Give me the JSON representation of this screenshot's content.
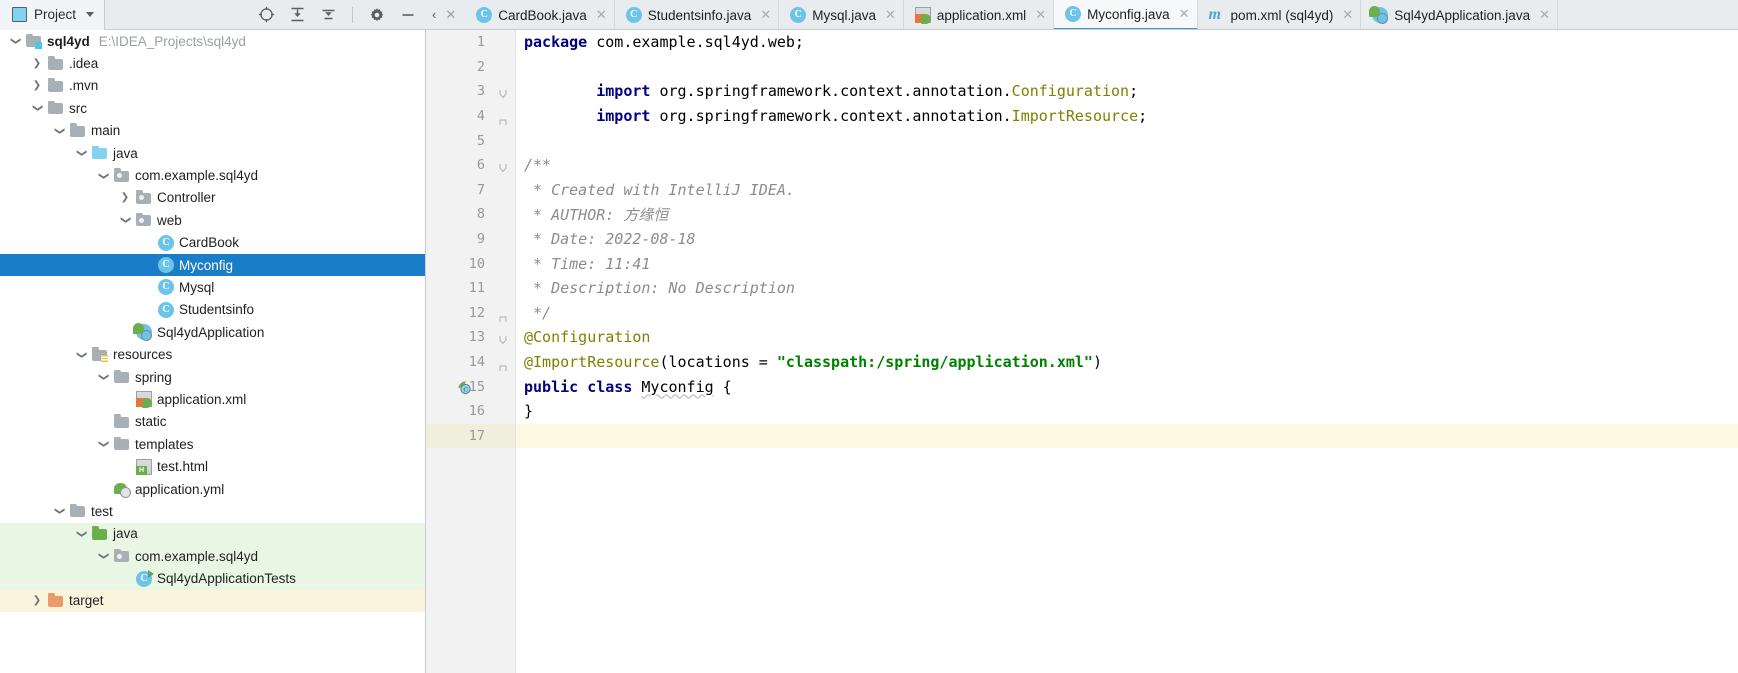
{
  "project_toolbar": {
    "tab_label": "Project",
    "icons": [
      {
        "name": "locate-icon",
        "glyph": "crosshair"
      },
      {
        "name": "expand-all-icon",
        "glyph": "expand"
      },
      {
        "name": "collapse-all-icon",
        "glyph": "collapse"
      },
      {
        "name": "settings-gear-icon",
        "glyph": "gear"
      },
      {
        "name": "minimize-icon",
        "glyph": "minus"
      }
    ]
  },
  "editor_tabs": {
    "scroll_left_label": "‹",
    "close_all_label": "✕",
    "items": [
      {
        "label": "CardBook.java",
        "icon": "java-class-icon",
        "icon_glyph": "C",
        "active": false
      },
      {
        "label": "Studentsinfo.java",
        "icon": "java-class-icon",
        "icon_glyph": "C",
        "active": false
      },
      {
        "label": "Mysql.java",
        "icon": "java-class-icon",
        "icon_glyph": "C",
        "active": false
      },
      {
        "label": "application.xml",
        "icon": "spring-xml-icon",
        "icon_glyph": "",
        "active": false
      },
      {
        "label": "Myconfig.java",
        "icon": "java-class-icon",
        "icon_glyph": "C",
        "active": true
      },
      {
        "label": "pom.xml (sql4yd)",
        "icon": "maven-icon",
        "icon_glyph": "m",
        "active": false
      },
      {
        "label": "Sql4ydApplication.java",
        "icon": "spring-boot-class-icon",
        "icon_glyph": "C",
        "active": false
      }
    ],
    "close_glyph": "✕"
  },
  "project_tree": {
    "rows": [
      {
        "indent": 0,
        "arrow": "down",
        "icon": "module-folder-icon",
        "label": "sql4yd",
        "path": "E:\\IDEA_Projects\\sql4yd",
        "bold": true,
        "state": "normal"
      },
      {
        "indent": 1,
        "arrow": "right",
        "icon": "folder-icon",
        "label": ".idea",
        "path": "",
        "bold": false,
        "state": "normal"
      },
      {
        "indent": 1,
        "arrow": "right",
        "icon": "folder-icon",
        "label": ".mvn",
        "path": "",
        "bold": false,
        "state": "normal"
      },
      {
        "indent": 1,
        "arrow": "down",
        "icon": "folder-icon",
        "label": "src",
        "path": "",
        "bold": false,
        "state": "normal"
      },
      {
        "indent": 2,
        "arrow": "down",
        "icon": "folder-icon",
        "label": "main",
        "path": "",
        "bold": false,
        "state": "normal"
      },
      {
        "indent": 3,
        "arrow": "down",
        "icon": "source-folder-icon",
        "label": "java",
        "path": "",
        "bold": false,
        "state": "normal"
      },
      {
        "indent": 4,
        "arrow": "down",
        "icon": "package-icon",
        "label": "com.example.sql4yd",
        "path": "",
        "bold": false,
        "state": "normal"
      },
      {
        "indent": 5,
        "arrow": "right",
        "icon": "package-icon",
        "label": "Controller",
        "path": "",
        "bold": false,
        "state": "normal"
      },
      {
        "indent": 5,
        "arrow": "down",
        "icon": "package-icon",
        "label": "web",
        "path": "",
        "bold": false,
        "state": "normal"
      },
      {
        "indent": 6,
        "arrow": "none",
        "icon": "java-class-icon",
        "label": "CardBook",
        "path": "",
        "bold": false,
        "state": "normal"
      },
      {
        "indent": 6,
        "arrow": "none",
        "icon": "java-class-icon",
        "label": "Myconfig",
        "path": "",
        "bold": false,
        "state": "selected"
      },
      {
        "indent": 6,
        "arrow": "none",
        "icon": "java-class-icon",
        "label": "Mysql",
        "path": "",
        "bold": false,
        "state": "normal"
      },
      {
        "indent": 6,
        "arrow": "none",
        "icon": "java-class-icon",
        "label": "Studentsinfo",
        "path": "",
        "bold": false,
        "state": "normal"
      },
      {
        "indent": 5,
        "arrow": "none",
        "icon": "spring-boot-class-icon",
        "label": "Sql4ydApplication",
        "path": "",
        "bold": false,
        "state": "normal"
      },
      {
        "indent": 3,
        "arrow": "down",
        "icon": "resources-folder-icon",
        "label": "resources",
        "path": "",
        "bold": false,
        "state": "normal"
      },
      {
        "indent": 4,
        "arrow": "down",
        "icon": "folder-icon",
        "label": "spring",
        "path": "",
        "bold": false,
        "state": "normal"
      },
      {
        "indent": 5,
        "arrow": "none",
        "icon": "spring-xml-icon",
        "label": "application.xml",
        "path": "",
        "bold": false,
        "state": "normal"
      },
      {
        "indent": 4,
        "arrow": "none",
        "icon": "folder-icon",
        "label": "static",
        "path": "",
        "bold": false,
        "state": "normal"
      },
      {
        "indent": 4,
        "arrow": "down",
        "icon": "folder-icon",
        "label": "templates",
        "path": "",
        "bold": false,
        "state": "normal"
      },
      {
        "indent": 5,
        "arrow": "none",
        "icon": "html-file-icon",
        "label": "test.html",
        "path": "",
        "bold": false,
        "state": "normal"
      },
      {
        "indent": 4,
        "arrow": "none",
        "icon": "spring-yml-icon",
        "label": "application.yml",
        "path": "",
        "bold": false,
        "state": "normal"
      },
      {
        "indent": 2,
        "arrow": "down",
        "icon": "folder-icon",
        "label": "test",
        "path": "",
        "bold": false,
        "state": "normal"
      },
      {
        "indent": 3,
        "arrow": "down",
        "icon": "test-source-folder-icon",
        "label": "java",
        "path": "",
        "bold": false,
        "state": "test-bg"
      },
      {
        "indent": 4,
        "arrow": "down",
        "icon": "package-icon",
        "label": "com.example.sql4yd",
        "path": "",
        "bold": false,
        "state": "test-bg"
      },
      {
        "indent": 5,
        "arrow": "none",
        "icon": "test-class-icon",
        "label": "Sql4ydApplicationTests",
        "path": "",
        "bold": false,
        "state": "test-bg"
      },
      {
        "indent": 1,
        "arrow": "right",
        "icon": "target-folder-icon",
        "label": "target",
        "path": "",
        "bold": false,
        "state": "target-bg"
      }
    ]
  },
  "editor": {
    "filename": "Myconfig.java",
    "caret_line": 17,
    "lines": [
      {
        "num": 1,
        "fold": "none",
        "gutter_icon": "none",
        "indent": 0,
        "tokens": [
          {
            "t": "package ",
            "c": "kw"
          },
          {
            "t": "com.example.sql4yd.web;",
            "c": "plain"
          }
        ]
      },
      {
        "num": 2,
        "fold": "none",
        "gutter_icon": "none",
        "indent": 0,
        "tokens": []
      },
      {
        "num": 3,
        "fold": "start",
        "gutter_icon": "none",
        "indent": 1,
        "tokens": [
          {
            "t": "import ",
            "c": "kw"
          },
          {
            "t": "org.springframework.context.annotation.",
            "c": "plain"
          },
          {
            "t": "Configuration",
            "c": "cls"
          },
          {
            "t": ";",
            "c": "plain"
          }
        ]
      },
      {
        "num": 4,
        "fold": "end",
        "gutter_icon": "none",
        "indent": 1,
        "tokens": [
          {
            "t": "import ",
            "c": "kw"
          },
          {
            "t": "org.springframework.context.annotation.",
            "c": "plain"
          },
          {
            "t": "ImportResource",
            "c": "cls"
          },
          {
            "t": ";",
            "c": "plain"
          }
        ]
      },
      {
        "num": 5,
        "fold": "none",
        "gutter_icon": "none",
        "indent": 0,
        "tokens": []
      },
      {
        "num": 6,
        "fold": "start",
        "gutter_icon": "none",
        "indent": 0,
        "tokens": [
          {
            "t": "/**",
            "c": "cmt"
          }
        ]
      },
      {
        "num": 7,
        "fold": "none",
        "gutter_icon": "none",
        "indent": 0,
        "tokens": [
          {
            "t": " * Created with IntelliJ IDEA.",
            "c": "cmt"
          }
        ]
      },
      {
        "num": 8,
        "fold": "none",
        "gutter_icon": "none",
        "indent": 0,
        "tokens": [
          {
            "t": " * AUTHOR: 方缘恒",
            "c": "cmt"
          }
        ]
      },
      {
        "num": 9,
        "fold": "none",
        "gutter_icon": "none",
        "indent": 0,
        "tokens": [
          {
            "t": " * Date: 2022-08-18",
            "c": "cmt"
          }
        ]
      },
      {
        "num": 10,
        "fold": "none",
        "gutter_icon": "none",
        "indent": 0,
        "tokens": [
          {
            "t": " * Time: 11:41",
            "c": "cmt"
          }
        ]
      },
      {
        "num": 11,
        "fold": "none",
        "gutter_icon": "none",
        "indent": 0,
        "tokens": [
          {
            "t": " * Description: No Description",
            "c": "cmt"
          }
        ]
      },
      {
        "num": 12,
        "fold": "end",
        "gutter_icon": "none",
        "indent": 0,
        "tokens": [
          {
            "t": " */",
            "c": "cmt"
          }
        ]
      },
      {
        "num": 13,
        "fold": "start",
        "gutter_icon": "none",
        "indent": 0,
        "tokens": [
          {
            "t": "@Configuration",
            "c": "ann"
          }
        ]
      },
      {
        "num": 14,
        "fold": "end",
        "gutter_icon": "none",
        "indent": 0,
        "tokens": [
          {
            "t": "@ImportResource",
            "c": "ann"
          },
          {
            "t": "(",
            "c": "plain"
          },
          {
            "t": "locations",
            "c": "plain"
          },
          {
            "t": " = ",
            "c": "plain"
          },
          {
            "t": "\"classpath:/spring/application.xml\"",
            "c": "str"
          },
          {
            "t": ")",
            "c": "plain"
          }
        ]
      },
      {
        "num": 15,
        "fold": "none",
        "gutter_icon": "spring-bean-icon",
        "indent": 0,
        "tokens": [
          {
            "t": "public ",
            "c": "kw"
          },
          {
            "t": "class ",
            "c": "kw"
          },
          {
            "t": "Myconfig",
            "c": "wavy"
          },
          {
            "t": " {",
            "c": "plain"
          }
        ]
      },
      {
        "num": 16,
        "fold": "none",
        "gutter_icon": "none",
        "indent": 0,
        "tokens": [
          {
            "t": "}",
            "c": "plain"
          }
        ]
      },
      {
        "num": 17,
        "fold": "none",
        "gutter_icon": "none",
        "indent": 0,
        "tokens": []
      }
    ]
  },
  "colors": {
    "selection_blue": "#1a7dc8",
    "test_green_bg": "#eaf6e4",
    "target_yellow_bg": "#fbf4dc",
    "caret_line_bg": "#fcfae3",
    "keyword": "#000080",
    "string": "#008000",
    "annotation": "#808000",
    "comment": "#8c8c8c",
    "tab_bar_bg": "#e8ecef",
    "active_tab_underline": "#4a90d9"
  }
}
